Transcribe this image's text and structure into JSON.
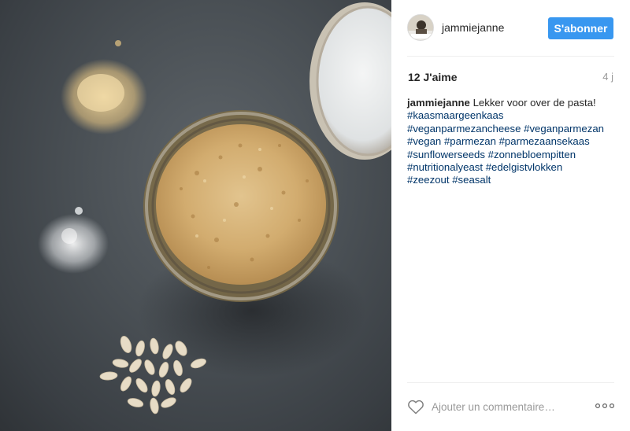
{
  "post": {
    "username": "jammiejanne",
    "follow_label": "S'abonner",
    "likes": "12 J'aime",
    "time": "4 j",
    "caption_author": "jammiejanne",
    "caption_text": " Lekker voor over de pasta!",
    "hashtags": [
      "#kaasmaargeenkaas",
      "#veganparmezancheese",
      "#veganparmezan",
      "#vegan",
      "#parmezan",
      "#parmezaansekaas",
      "#sunflowerseeds",
      "#zonnebloempitten",
      "#nutritionalyeast",
      "#edelgistvlokken",
      "#zeezout",
      "#seasalt"
    ],
    "comment_placeholder": "Ajouter un commentaire…",
    "more_label": "ooo",
    "photo_icon": "photo"
  },
  "colors": {
    "accent": "#3897f0",
    "hashtag": "#003569",
    "muted": "#999999"
  }
}
